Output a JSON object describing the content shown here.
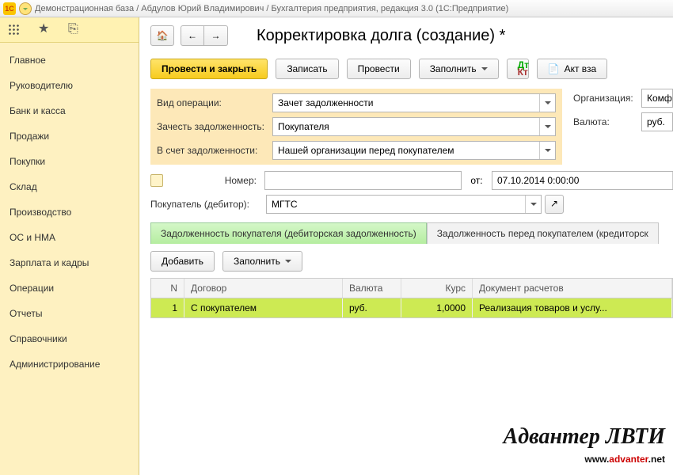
{
  "window": {
    "title": "Демонстрационная база / Абдулов Юрий Владимирович / Бухгалтерия предприятия, редакция 3.0  (1С:Предприятие)"
  },
  "sidebar": {
    "items": [
      {
        "label": "Главное"
      },
      {
        "label": "Руководителю"
      },
      {
        "label": "Банк и касса"
      },
      {
        "label": "Продажи"
      },
      {
        "label": "Покупки"
      },
      {
        "label": "Склад"
      },
      {
        "label": "Производство"
      },
      {
        "label": "ОС и НМА"
      },
      {
        "label": "Зарплата и кадры"
      },
      {
        "label": "Операции"
      },
      {
        "label": "Отчеты"
      },
      {
        "label": "Справочники"
      },
      {
        "label": "Администрирование"
      }
    ]
  },
  "page": {
    "title": "Корректировка долга (создание) *"
  },
  "toolbar": {
    "post_close": "Провести и закрыть",
    "save": "Записать",
    "post": "Провести",
    "fill": "Заполнить",
    "act": "Акт вза"
  },
  "fields": {
    "op_kind_label": "Вид операции:",
    "op_kind_value": "Зачет задолженности",
    "offset_label": "Зачесть задолженность:",
    "offset_value": "Покупателя",
    "against_label": "В счет задолженности:",
    "against_value": "Нашей организации перед покупателем",
    "org_label": "Организация:",
    "org_value": "Комф",
    "cur_label": "Валюта:",
    "cur_value": "руб.",
    "num_label": "Номер:",
    "num_value": "",
    "from_label": "от:",
    "date_value": "07.10.2014  0:00:00",
    "buyer_label": "Покупатель (дебитор):",
    "buyer_value": "МГТС"
  },
  "tabs": {
    "t1": "Задолженность покупателя (дебиторская задолженность)",
    "t2": "Задолженность перед покупателем (кредиторск"
  },
  "subtoolbar": {
    "add": "Добавить",
    "fill": "Заполнить"
  },
  "table": {
    "headers": {
      "n": "N",
      "contract": "Договор",
      "currency": "Валюта",
      "rate": "Курс",
      "doc": "Документ расчетов"
    },
    "rows": [
      {
        "n": "1",
        "contract": "С покупателем",
        "currency": "руб.",
        "rate": "1,0000",
        "doc": "Реализация товаров и услу..."
      }
    ]
  },
  "watermark": {
    "l1": "Адвантер ЛВТИ",
    "pre": "www.",
    "brand": "advanter",
    "suf": ".net"
  }
}
